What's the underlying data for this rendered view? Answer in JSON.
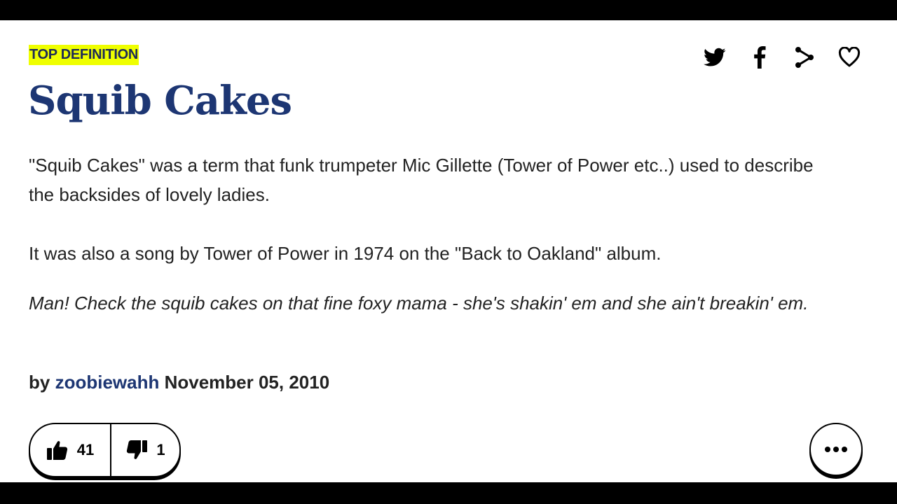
{
  "definition": {
    "badge": "TOP DEFINITION",
    "word": "Squib Cakes",
    "meaning": [
      "\"Squib Cakes\" was a term that funk trumpeter Mic Gillette (Tower of Power etc..) used to describe the backsides of lovely ladies.",
      "It was also a song by Tower of Power in 1974 on the \"Back to Oakland\" album."
    ],
    "example": "Man! Check the squib cakes on that fine foxy mama - she's shakin' em and she ain't breakin' em.",
    "contributor": {
      "by": "by",
      "author": "zoobiewahh",
      "date": "November 05, 2010"
    },
    "votes": {
      "up": "41",
      "down": "1"
    }
  },
  "actions": {
    "icons": [
      "twitter-icon",
      "facebook-icon",
      "share-icon",
      "heart-icon"
    ]
  },
  "colors": {
    "badge_bg": "#efff00",
    "title": "#1d3673",
    "text": "#222222"
  }
}
